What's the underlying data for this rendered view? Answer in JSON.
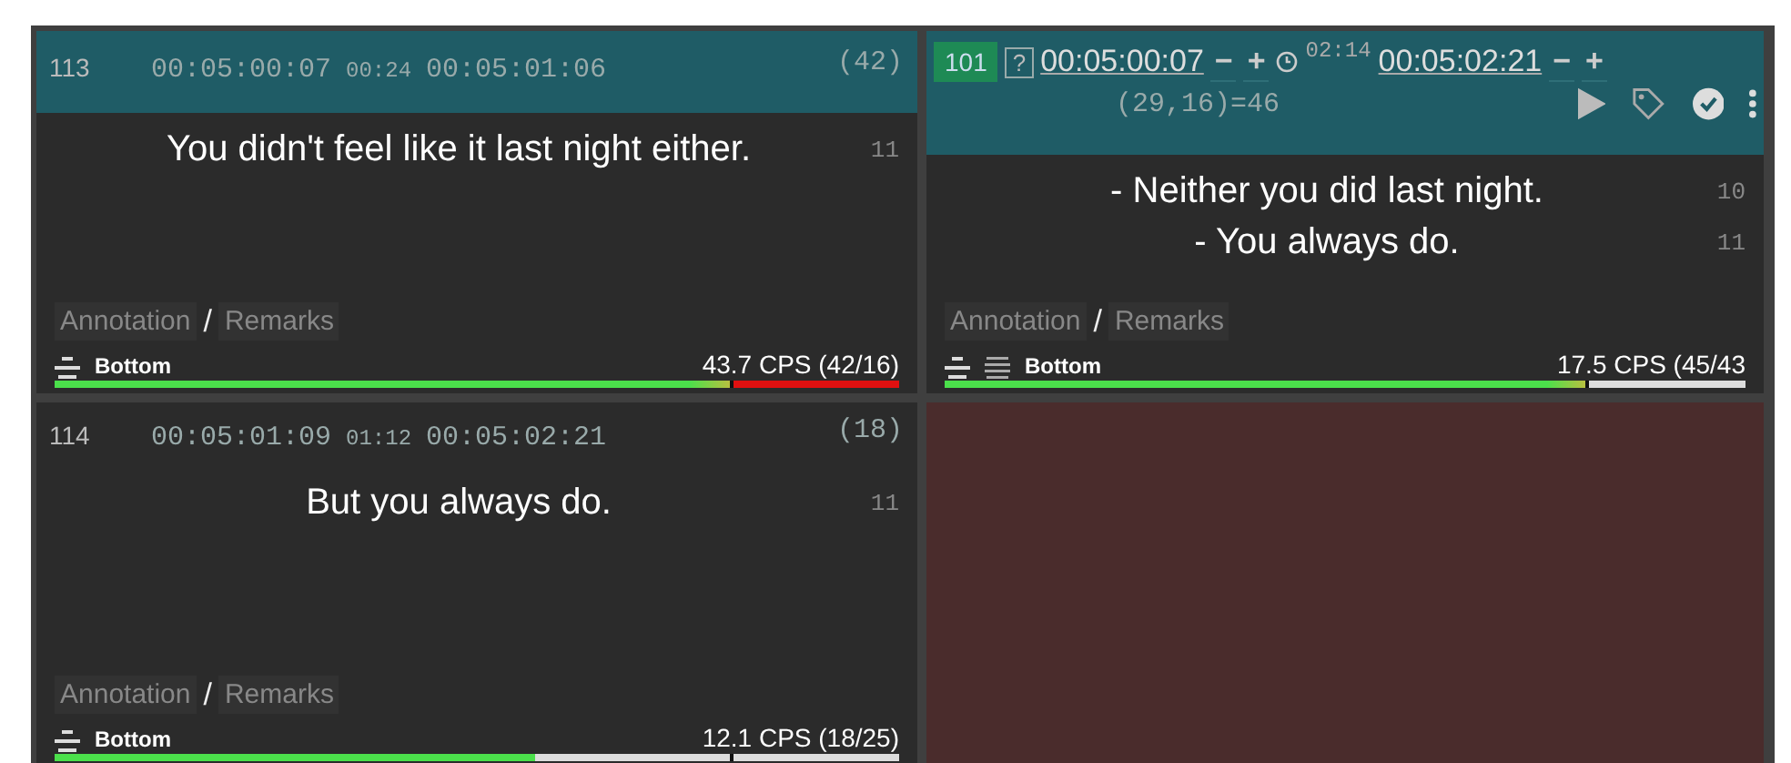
{
  "panels": [
    {
      "kind": "compact",
      "selected": true,
      "number": "113",
      "start": "00:05:00:07",
      "duration": "00:24",
      "end": "00:05:01:06",
      "count": "(42)",
      "lines": [
        {
          "text": "You didn't feel like it last night either.",
          "chars": "11"
        }
      ],
      "annotation": "Annotation",
      "separator": "/",
      "remarks": "Remarks",
      "position": "Bottom",
      "cps": "43.7 CPS (42/16)",
      "meter": {
        "level": 0.8,
        "color": "#e01010"
      }
    },
    {
      "kind": "editor",
      "selected": true,
      "number": "101",
      "flag": "?",
      "start": "00:05:00:07",
      "start_nudge": [
        "−",
        "+"
      ],
      "duration": "02:14",
      "end": "00:05:02:21",
      "end_nudge": [
        "−",
        "+"
      ],
      "stats": "(29,16)=46",
      "lines": [
        {
          "text": "- Neither you did last night.",
          "chars": "10"
        },
        {
          "text": "- You always do.",
          "chars": "11"
        }
      ],
      "annotation": "Annotation",
      "separator": "/",
      "remarks": "Remarks",
      "position": "Bottom",
      "cps": "17.5 CPS (45/43",
      "meter": {
        "level": 0.8,
        "color": "#dddddd"
      }
    },
    {
      "kind": "compact",
      "selected": false,
      "number": "114",
      "start": "00:05:01:09",
      "duration": "01:12",
      "end": "00:05:02:21",
      "count": "(18)",
      "lines": [
        {
          "text": "But you always do.",
          "chars": "11"
        }
      ],
      "annotation": "Annotation",
      "separator": "/",
      "remarks": "Remarks",
      "position": "Bottom",
      "cps": "12.1 CPS (18/25)",
      "meter": {
        "level": 0.57,
        "color": "#dddddd"
      }
    },
    {
      "kind": "empty"
    }
  ]
}
